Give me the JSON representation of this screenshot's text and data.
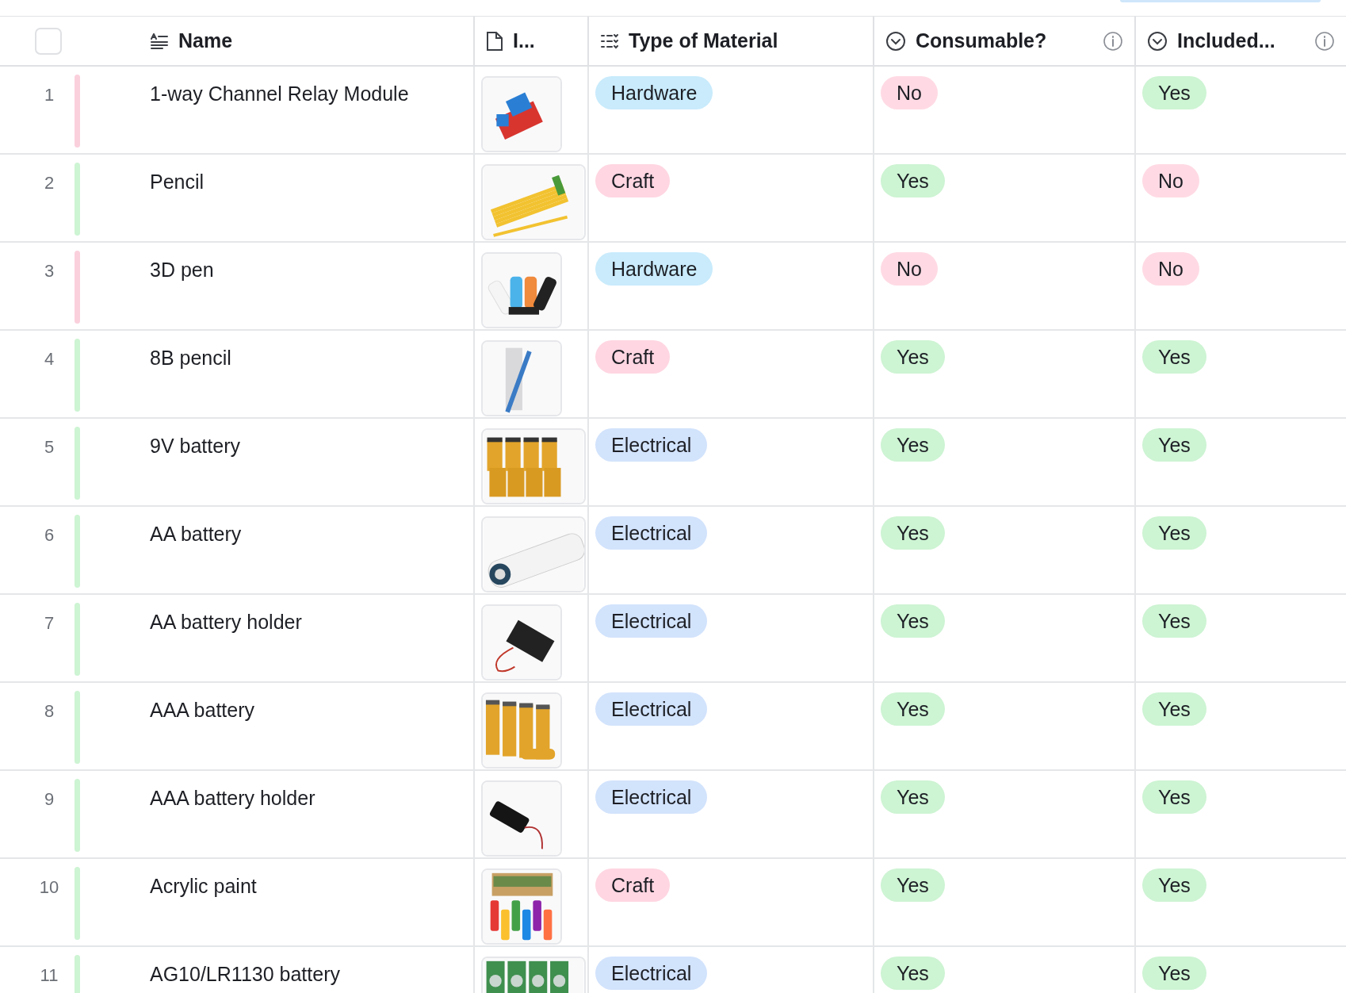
{
  "columns": [
    {
      "kind": "name",
      "label": "Name"
    },
    {
      "kind": "attachment",
      "label": "I..."
    },
    {
      "kind": "list",
      "label": "Type of Material"
    },
    {
      "kind": "select",
      "label": "Consumable?",
      "info": true
    },
    {
      "kind": "select",
      "label": "Included...",
      "info": true
    }
  ],
  "select_all": {
    "checked": false
  },
  "rows": [
    {
      "number": "1",
      "color": "#fbd0dd",
      "name": "1-way Channel Relay Module",
      "type": {
        "label": "Hardware",
        "color": "#c9ebfc"
      },
      "consumable": {
        "label": "No",
        "color": "#ffdae4"
      },
      "included": {
        "label": "Yes",
        "color": "#cdf4d3"
      }
    },
    {
      "number": "2",
      "color": "#cdf4d3",
      "name": "Pencil",
      "type": {
        "label": "Craft",
        "color": "#ffd6e2"
      },
      "consumable": {
        "label": "Yes",
        "color": "#cdf4d3"
      },
      "included": {
        "label": "No",
        "color": "#ffdae4"
      }
    },
    {
      "number": "3",
      "color": "#fbd0dd",
      "name": "3D pen",
      "type": {
        "label": "Hardware",
        "color": "#c9ebfc"
      },
      "consumable": {
        "label": "No",
        "color": "#ffdae4"
      },
      "included": {
        "label": "No",
        "color": "#ffdae4"
      }
    },
    {
      "number": "4",
      "color": "#cdf4d3",
      "name": "8B pencil",
      "type": {
        "label": "Craft",
        "color": "#ffd6e2"
      },
      "consumable": {
        "label": "Yes",
        "color": "#cdf4d3"
      },
      "included": {
        "label": "Yes",
        "color": "#cdf4d3"
      }
    },
    {
      "number": "5",
      "color": "#cdf4d3",
      "name": "9V battery",
      "type": {
        "label": "Electrical",
        "color": "#d2e3fc"
      },
      "consumable": {
        "label": "Yes",
        "color": "#cdf4d3"
      },
      "included": {
        "label": "Yes",
        "color": "#cdf4d3"
      }
    },
    {
      "number": "6",
      "color": "#cdf4d3",
      "name": "AA battery",
      "type": {
        "label": "Electrical",
        "color": "#d2e3fc"
      },
      "consumable": {
        "label": "Yes",
        "color": "#cdf4d3"
      },
      "included": {
        "label": "Yes",
        "color": "#cdf4d3"
      }
    },
    {
      "number": "7",
      "color": "#cdf4d3",
      "name": "AA battery holder",
      "type": {
        "label": "Electrical",
        "color": "#d2e3fc"
      },
      "consumable": {
        "label": "Yes",
        "color": "#cdf4d3"
      },
      "included": {
        "label": "Yes",
        "color": "#cdf4d3"
      }
    },
    {
      "number": "8",
      "color": "#cdf4d3",
      "name": "AAA battery",
      "type": {
        "label": "Electrical",
        "color": "#d2e3fc"
      },
      "consumable": {
        "label": "Yes",
        "color": "#cdf4d3"
      },
      "included": {
        "label": "Yes",
        "color": "#cdf4d3"
      }
    },
    {
      "number": "9",
      "color": "#cdf4d3",
      "name": "AAA battery holder",
      "type": {
        "label": "Electrical",
        "color": "#d2e3fc"
      },
      "consumable": {
        "label": "Yes",
        "color": "#cdf4d3"
      },
      "included": {
        "label": "Yes",
        "color": "#cdf4d3"
      }
    },
    {
      "number": "10",
      "color": "#cdf4d3",
      "name": "Acrylic paint",
      "type": {
        "label": "Craft",
        "color": "#ffd6e2"
      },
      "consumable": {
        "label": "Yes",
        "color": "#cdf4d3"
      },
      "included": {
        "label": "Yes",
        "color": "#cdf4d3"
      }
    },
    {
      "number": "11",
      "color": "#cdf4d3",
      "name": "AG10/LR1130 battery",
      "type": {
        "label": "Electrical",
        "color": "#d2e3fc"
      },
      "consumable": {
        "label": "Yes",
        "color": "#cdf4d3"
      },
      "included": {
        "label": "Yes",
        "color": "#cdf4d3"
      }
    }
  ]
}
